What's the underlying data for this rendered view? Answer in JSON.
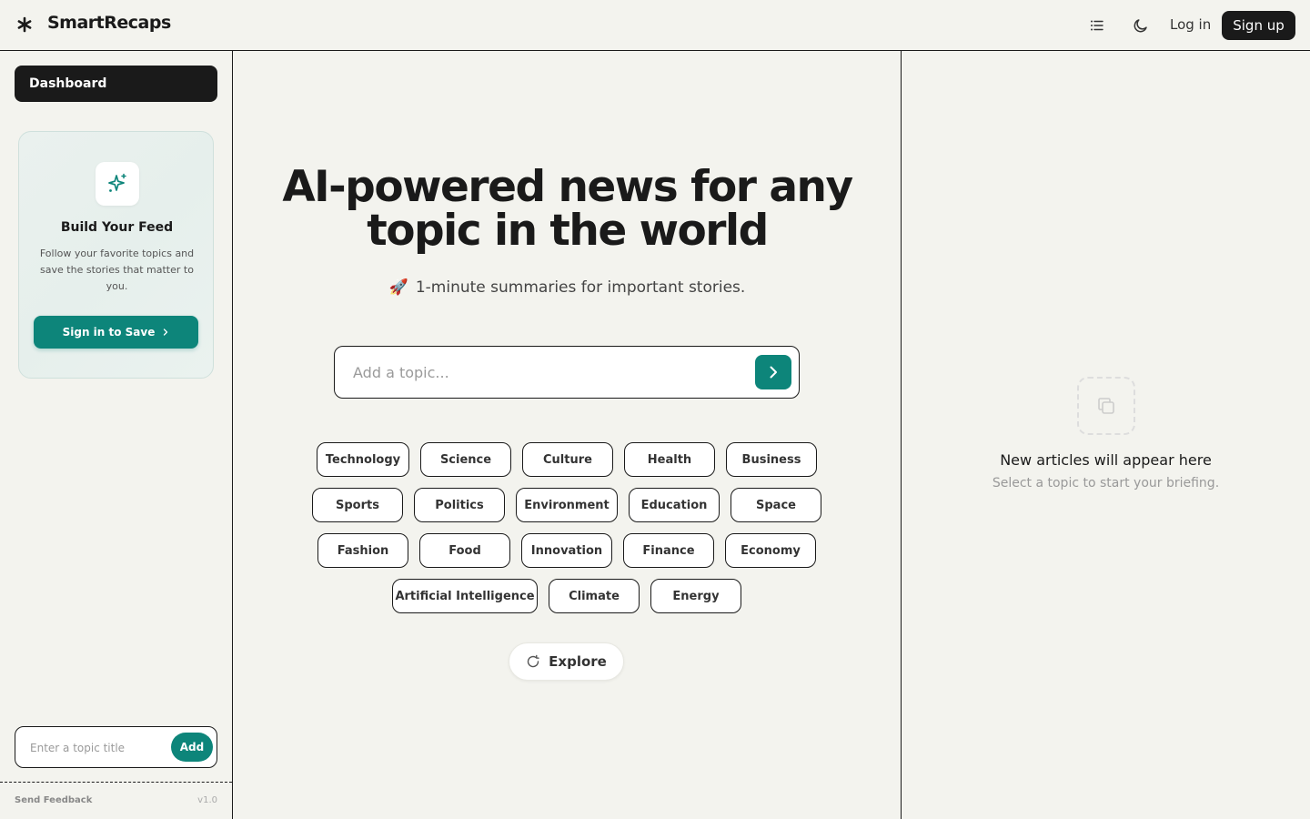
{
  "header": {
    "brand": "SmartRecaps",
    "login_label": "Log in",
    "signup_label": "Sign up",
    "logo_icon": "asterisk-icon",
    "list_icon": "list-icon",
    "theme_icon": "moon-icon"
  },
  "sidebar": {
    "dashboard_label": "Dashboard",
    "card": {
      "icon": "sparkles-icon",
      "title": "Build Your Feed",
      "description": "Follow your favorite topics and save the stories that matter to you.",
      "button_label": "Sign in to Save"
    },
    "topic_form": {
      "placeholder": "Enter a topic title",
      "value": "",
      "add_label": "Add"
    },
    "footer": {
      "feedback_label": "Send Feedback",
      "version": "v1.0"
    }
  },
  "main": {
    "title": "AI-powered news for any topic in the world",
    "subtitle_icon": "🚀",
    "subtitle": "1-minute summaries for important stories.",
    "search": {
      "placeholder": "Add a topic...",
      "value": ""
    },
    "topics": [
      "Technology",
      "Science",
      "Culture",
      "Health",
      "Business",
      "Sports",
      "Politics",
      "Environment",
      "Education",
      "Space",
      "Fashion",
      "Food",
      "Innovation",
      "Finance",
      "Economy",
      "Artificial Intelligence",
      "Climate",
      "Energy"
    ],
    "explore_label": "Explore"
  },
  "right_panel": {
    "empty_title": "New articles will appear here",
    "empty_subtitle": "Select a topic to start your briefing."
  },
  "colors": {
    "accent": "#0d857a",
    "background": "#f3f3ee",
    "dark": "#1a1a1a",
    "rocket": "#e0463a"
  }
}
